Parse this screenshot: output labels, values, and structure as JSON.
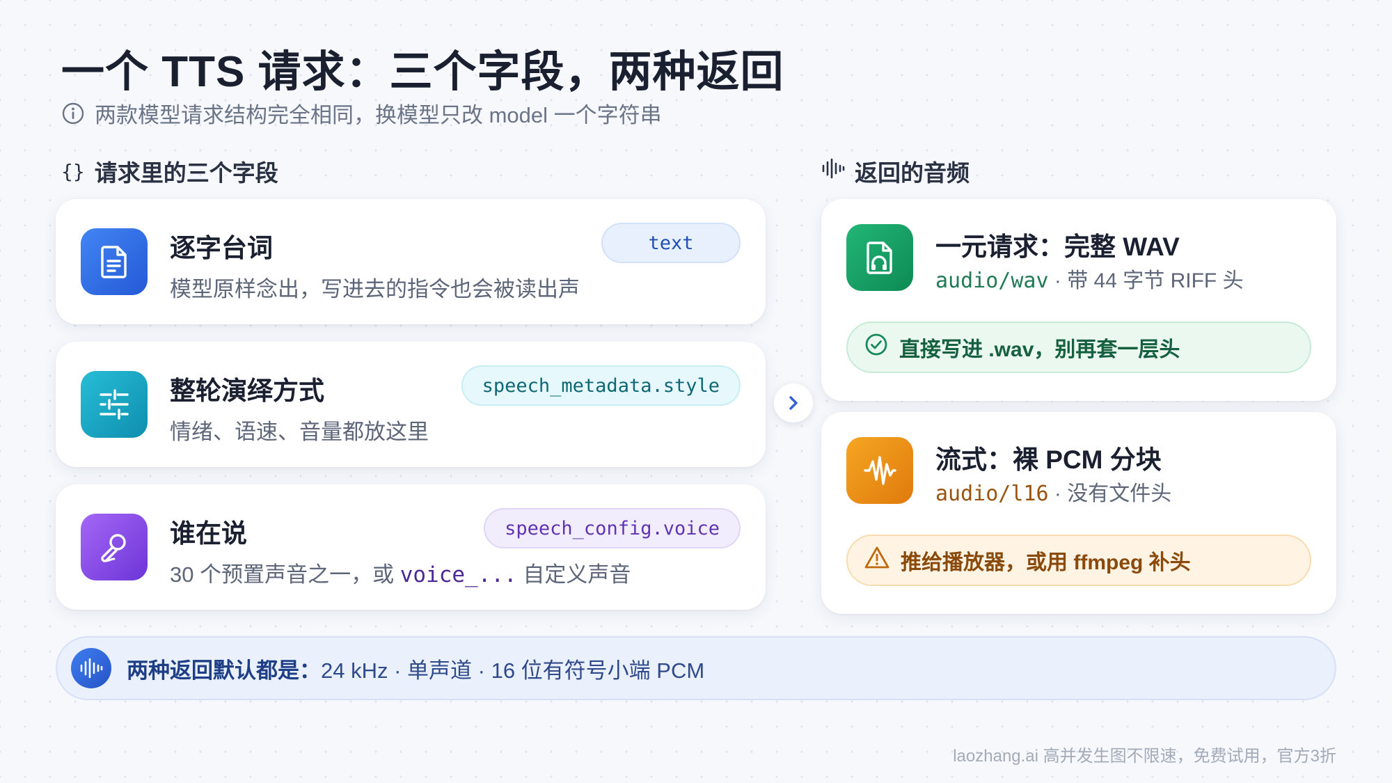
{
  "title": "一个 TTS 请求：三个字段，两种返回",
  "subtitle": "两款模型请求结构完全相同，换模型只改 model 一个字符串",
  "sections": {
    "request_label": "请求里的三个字段",
    "request_symbol": "{}",
    "response_label": "返回的音频"
  },
  "fields": [
    {
      "title": "逐字台词",
      "desc": "模型原样念出，写进去的指令也会被读出声",
      "chip": "text",
      "icon": "document-icon",
      "color": "#2f6fe8"
    },
    {
      "title": "整轮演绎方式",
      "desc": "情绪、语速、音量都放这里",
      "chip": "speech_metadata.style",
      "icon": "sliders-icon",
      "color": "#1aa6c2"
    },
    {
      "title": "谁在说",
      "desc_prefix": "30 个预置声音之一，或 ",
      "desc_code": "voice_...",
      "desc_suffix": " 自定义声音",
      "chip": "speech_config.voice",
      "icon": "microphone-icon",
      "color": "#8b4be8"
    }
  ],
  "responses": [
    {
      "title": "一元请求：完整 WAV",
      "content_type": "audio/wav",
      "detail": " · 带 44 字节 RIFF 头",
      "note": "直接写进 .wav，别再套一层头",
      "icon": "audio-file-icon",
      "color": "#169a63",
      "note_icon": "check-circle-icon"
    },
    {
      "title": "流式：裸 PCM 分块",
      "content_type": "audio/l16",
      "detail": " · 没有文件头",
      "note": "推给播放器，或用 ffmpeg 补头",
      "icon": "waveform-icon",
      "color": "#ec8a12",
      "note_icon": "warning-icon"
    }
  ],
  "footer": {
    "label": "两种返回默认都是：",
    "value": "24 kHz · 单声道 · 16 位有符号小端 PCM"
  },
  "watermark": "laozhang.ai 高并发生图不限速，免费试用，官方3折"
}
